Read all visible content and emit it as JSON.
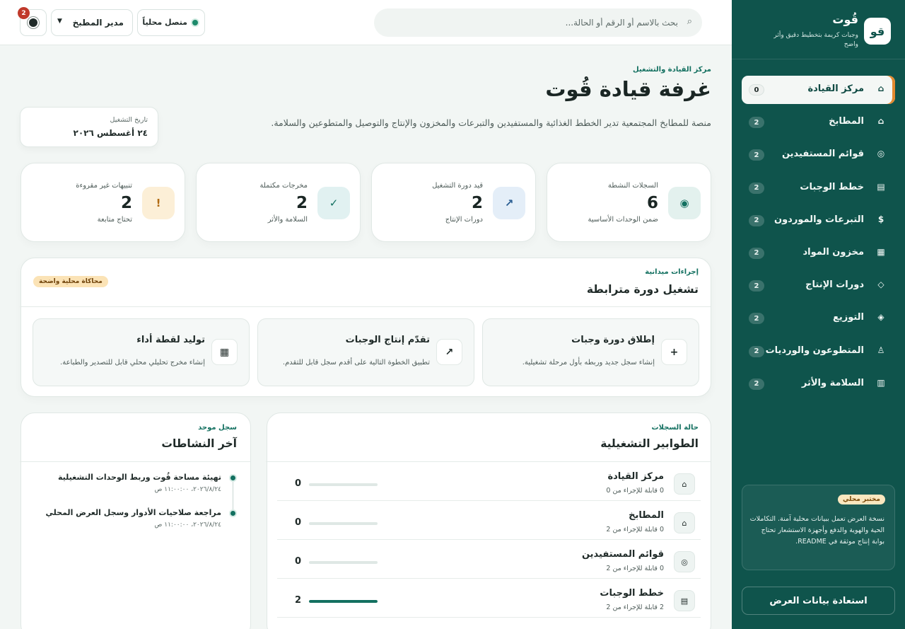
{
  "brand": {
    "logo": "قو",
    "title": "قُوت",
    "subtitle": "وجبات كريمة بتخطيط دقيق وأثر واضح"
  },
  "sidebar": {
    "items": [
      {
        "icon": "⌂",
        "icon_name": "home-icon",
        "label": "مركز القيادة",
        "badge": "0",
        "active": true
      },
      {
        "icon": "⌂",
        "icon_name": "kitchen-icon",
        "label": "المطابخ",
        "badge": "2"
      },
      {
        "icon": "◎",
        "icon_name": "target-icon",
        "label": "قوائم المستفيدين",
        "badge": "2"
      },
      {
        "icon": "▤",
        "icon_name": "list-icon",
        "label": "خطط الوجبات",
        "badge": "2"
      },
      {
        "icon": "$",
        "icon_name": "dollar-icon",
        "label": "التبرعات والموردون",
        "badge": "2"
      },
      {
        "icon": "▦",
        "icon_name": "grid-icon",
        "label": "مخزون المواد",
        "badge": "2"
      },
      {
        "icon": "◇",
        "icon_name": "diamond-outline-icon",
        "label": "دورات الإنتاج",
        "badge": "2"
      },
      {
        "icon": "◈",
        "icon_name": "diamond-filled-icon",
        "label": "التوزيع",
        "badge": "2"
      },
      {
        "icon": "♙",
        "icon_name": "person-icon",
        "label": "المتطوعون والورديات",
        "badge": "2"
      },
      {
        "icon": "▥",
        "icon_name": "report-icon",
        "label": "السلامة والأثر",
        "badge": "2"
      }
    ],
    "lab_chip": "مختبر محلي",
    "lab_text": "نسخة العرض تعمل ببيانات محلية آمنة. التكاملات الحية والهوية والدفع وأجهزة الاستشعار تحتاج بوابة إنتاج موثقة في README.",
    "restore_label": "استعادة بيانات العرض"
  },
  "topbar": {
    "search_placeholder": "بحث بالاسم أو الرقم أو الحالة...",
    "status_label": "متصل محلياً",
    "role_label": "مدير المطبخ",
    "notify_count": "2"
  },
  "page": {
    "eyebrow": "مركز القيادة والتشغيل",
    "title": "غرفة قيادة قُوت",
    "description": "منصة للمطابخ المجتمعية تدير الخطط الغذائية والمستفيدين والتبرعات والمخزون والإنتاج والتوصيل والمتطوعين والسلامة.",
    "date_label": "تاريخ التشغيل",
    "date_value": "٢٤ أغسطس ٢٠٢٦"
  },
  "stats": [
    {
      "label": "السجلات النشطة",
      "value": "6",
      "sub": "ضمن الوحدات الأساسية",
      "icon": "◉",
      "icon_name": "record-icon",
      "icon_bg": "#e3f1ee",
      "icon_color": "#137060"
    },
    {
      "label": "قيد دورة التشغيل",
      "value": "2",
      "sub": "دورات الإنتاج",
      "icon": "↗",
      "icon_name": "arrow-up-right-icon",
      "icon_bg": "#e4eef8",
      "icon_color": "#2a5d92"
    },
    {
      "label": "مخرجات مكتملة",
      "value": "2",
      "sub": "السلامة والأثر",
      "icon": "✓",
      "icon_name": "check-icon",
      "icon_bg": "#e1f1f1",
      "icon_color": "#137060"
    },
    {
      "label": "تنبيهات غير مقروءة",
      "value": "2",
      "sub": "تحتاج متابعة",
      "icon": "!",
      "icon_name": "alert-icon",
      "icon_bg": "#fcefd7",
      "icon_color": "#b06a12"
    }
  ],
  "ops": {
    "eyebrow": "إجراءات ميدانية",
    "title": "تشغيل دورة مترابطة",
    "chip": "محاكاة محلية واضحة",
    "actions": [
      {
        "icon": "+",
        "icon_name": "plus-icon",
        "title": "إطلاق دورة وجبات",
        "desc": "إنشاء سجل جديد وربطه بأول مرحلة تشغيلية."
      },
      {
        "icon": "↗",
        "icon_name": "arrow-up-right-icon",
        "title": "تقدّم إنتاج الوجبات",
        "desc": "تطبيق الخطوة التالية على أقدم سجل قابل للتقدم."
      },
      {
        "icon": "▦",
        "icon_name": "report-icon",
        "title": "توليد لقطة أداء",
        "desc": "إنشاء مخرج تحليلي محلي قابل للتصدير والطباعة."
      }
    ]
  },
  "queues": {
    "eyebrow": "حالة السجلات",
    "title": "الطوابير التشغيلية",
    "rows": [
      {
        "icon": "⌂",
        "icon_name": "home-icon",
        "name": "مركز القيادة",
        "sub": "0 قابلة للإجراء من 0",
        "count": "0",
        "progress": 0
      },
      {
        "icon": "⌂",
        "icon_name": "kitchen-icon",
        "name": "المطابخ",
        "sub": "0 قابلة للإجراء من 2",
        "count": "0",
        "progress": 0
      },
      {
        "icon": "◎",
        "icon_name": "target-icon",
        "name": "قوائم المستفيدين",
        "sub": "0 قابلة للإجراء من 2",
        "count": "0",
        "progress": 0
      },
      {
        "icon": "▤",
        "icon_name": "list-icon",
        "name": "خطط الوجبات",
        "sub": "2 قابلة للإجراء من 2",
        "count": "2",
        "progress": 1
      }
    ]
  },
  "activity": {
    "eyebrow": "سجل موحد",
    "title": "آخر النشاطات",
    "items": [
      {
        "text": "تهيئة مساحة قُوت وربط الوحدات التشغيلية",
        "time": "٢٠٢٦/٨/٢٤، ١١:٠٠:٠٠ ص"
      },
      {
        "text": "مراجعة صلاحيات الأدوار وسجل العرض المحلي",
        "time": "٢٠٢٦/٨/٢٤، ١١:٠٠:٠٠ ص"
      }
    ]
  }
}
